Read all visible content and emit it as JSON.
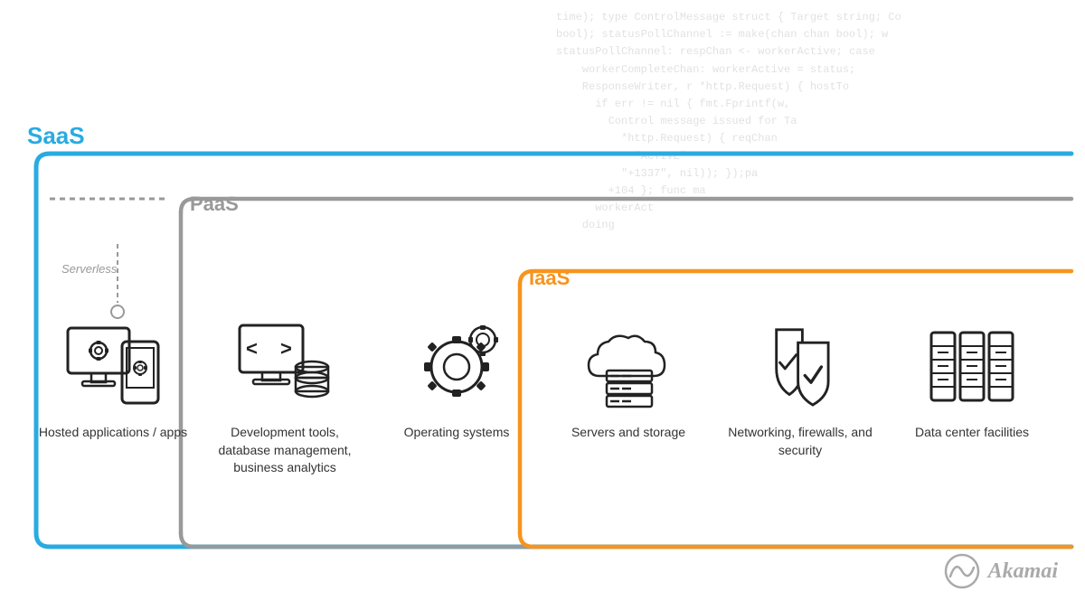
{
  "code_lines": [
    "time); type ControlMessage struct { Target string; Co",
    "bool); statusPollChannel := make(chan chan bool); w",
    "statusPollChannel: respChan <- workerActive; case",
    "    workerCompleteChan: workerActive = status;",
    "    ResponseWriter, r *http.Request) { hostTo",
    "      if err != nil { fmt.Fprintf(w,",
    "        Control message issued for Ta",
    "          *http.Request) { reqChan",
    "            \"ACTIVE\"",
    "          \"+1337\", nil)); });pa",
    "        +104 }; func ma",
    "      workerAct",
    "    doing"
  ],
  "labels": {
    "saas": "SaaS",
    "paas": "PaaS",
    "iaas": "IaaS",
    "serverless": "Serverless",
    "akamai": "Akamai"
  },
  "items": [
    {
      "id": "hosted-apps",
      "label": "Hosted applications / apps",
      "icon": "hosted-apps-icon"
    },
    {
      "id": "dev-tools",
      "label": "Development tools, database management, business analytics",
      "icon": "dev-tools-icon"
    },
    {
      "id": "operating-systems",
      "label": "Operating systems",
      "icon": "os-icon"
    },
    {
      "id": "servers-storage",
      "label": "Servers and storage",
      "icon": "servers-icon"
    },
    {
      "id": "networking",
      "label": "Networking, firewalls, and security",
      "icon": "networking-icon"
    },
    {
      "id": "data-center",
      "label": "Data center facilities",
      "icon": "datacenter-icon"
    }
  ],
  "colors": {
    "saas": "#29ABE2",
    "paas": "#999999",
    "iaas": "#F7941D",
    "text": "#333333",
    "icon": "#222222"
  }
}
